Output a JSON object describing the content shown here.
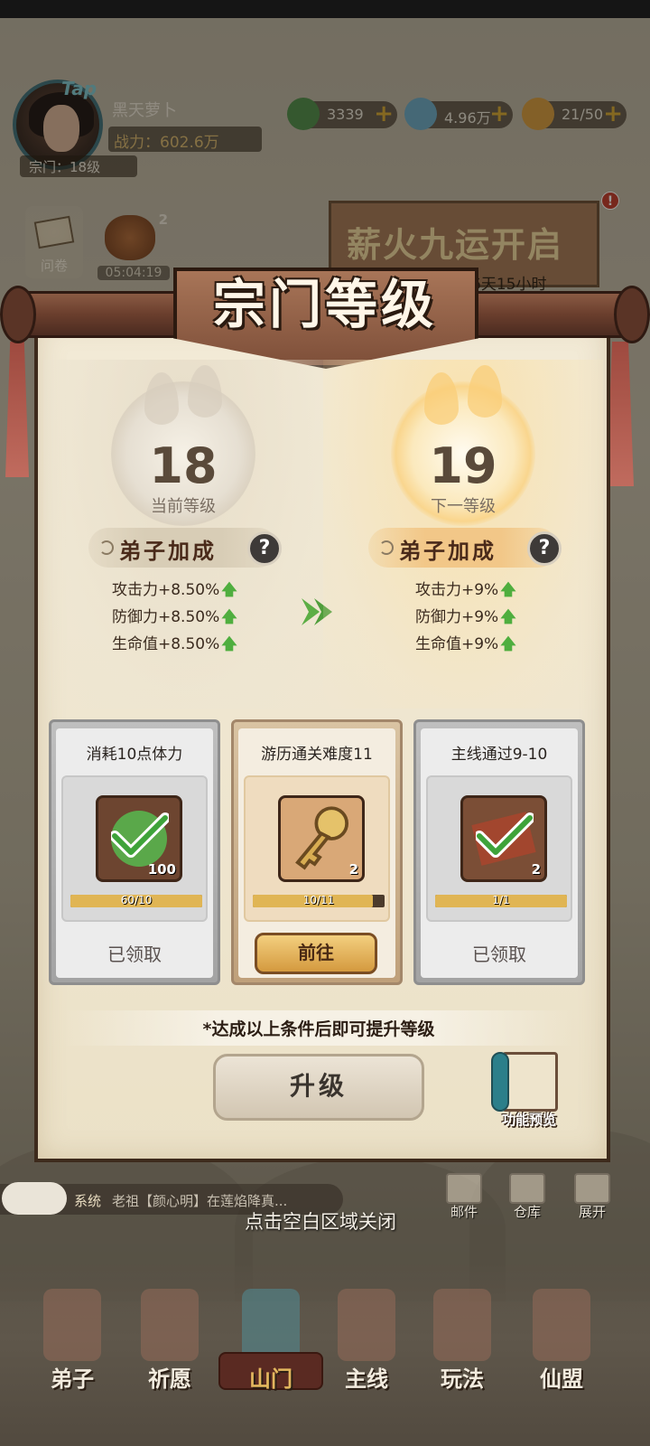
{
  "player": {
    "name": "黑天萝卜",
    "power": "战力：602.6万",
    "sect_level": "宗门：18级",
    "tap_label": "Tap"
  },
  "resources": [
    {
      "icon": "jade-icon",
      "value": "3339",
      "color": "#4f8c4a"
    },
    {
      "icon": "crystal-icon",
      "value": "4.96万",
      "color": "#6aa8c4"
    },
    {
      "icon": "stamina-icon",
      "value": "21/50",
      "color": "#d49a3f"
    }
  ],
  "top_buttons": {
    "questionnaire": "问卷",
    "bag_count": "2",
    "bag_timer": "05:04:19"
  },
  "event": {
    "title": "薪火九运开启",
    "countdown": "结束还剩6天15小时",
    "badge": "!"
  },
  "modal": {
    "title": "宗门等级",
    "current": {
      "level": "18",
      "label": "当前等级",
      "bonus_title": "弟子加成",
      "stats": [
        "攻击力+8.50%",
        "防御力+8.50%",
        "生命值+8.50%"
      ]
    },
    "next": {
      "level": "19",
      "label": "下一等级",
      "bonus_title": "弟子加成",
      "stats": [
        "攻击力+9%",
        "防御力+9%",
        "生命值+9%"
      ]
    },
    "help": "?",
    "up_arrow": "🡅",
    "conditions": [
      {
        "name": "消耗10点体力",
        "item": "jade-stamina-icon",
        "qty": "100",
        "progress_text": "60/10",
        "progress": 1.0,
        "status": "已领取",
        "done": true
      },
      {
        "name": "游历通关难度11",
        "item": "golden-key-icon",
        "qty": "2",
        "progress_text": "10/11",
        "progress": 0.909,
        "button": "前往",
        "done": false
      },
      {
        "name": "主线通过9-10",
        "item": "scroll-map-icon",
        "qty": "2",
        "progress_text": "1/1",
        "progress": 1.0,
        "status": "已领取",
        "done": true
      }
    ],
    "condition_note": "*达成以上条件后即可提升等级",
    "upgrade_label": "升级",
    "preview_label": "功能预览"
  },
  "chat": {
    "channel": "系统",
    "message": "老祖【颜心明】在莲焰降真..."
  },
  "close_hint": "点击空白区域关闭",
  "side_buttons": [
    {
      "label": "邮件",
      "icon": "mail-icon"
    },
    {
      "label": "仓库",
      "icon": "warehouse-icon"
    },
    {
      "label": "展开",
      "icon": "expand-icon"
    }
  ],
  "nav": [
    {
      "label": "弟子",
      "icon": "disciple-icon"
    },
    {
      "label": "祈愿",
      "icon": "wish-icon"
    },
    {
      "label": "山门",
      "icon": "gate-icon",
      "active": true
    },
    {
      "label": "主线",
      "icon": "mainline-icon"
    },
    {
      "label": "玩法",
      "icon": "gameplay-icon"
    },
    {
      "label": "仙盟",
      "icon": "alliance-icon"
    }
  ]
}
